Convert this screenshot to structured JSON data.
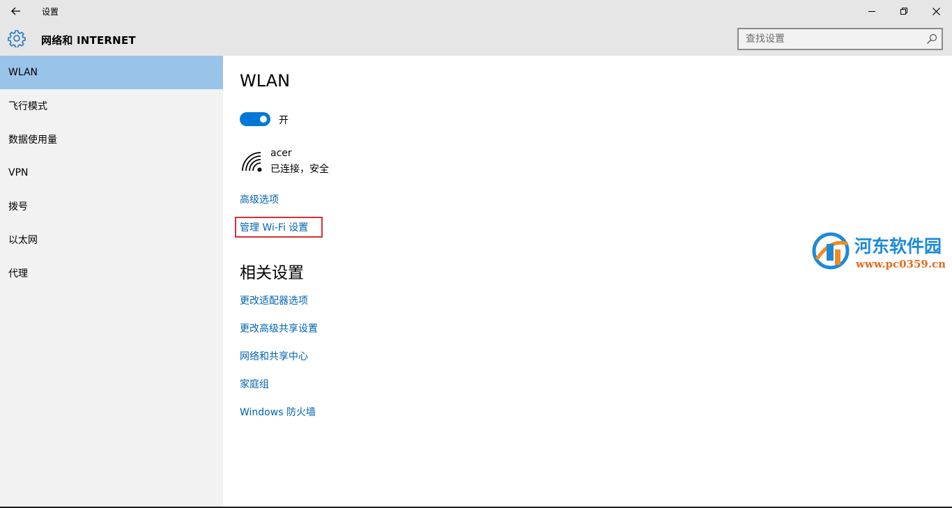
{
  "window": {
    "title": "设置",
    "back_icon": "back-arrow-icon",
    "controls": [
      "minimize-icon",
      "maximize-icon",
      "close-icon"
    ]
  },
  "header": {
    "icon": "gear-icon",
    "title": "网络和 INTERNET",
    "search": {
      "placeholder": "查找设置",
      "value": ""
    }
  },
  "sidebar": {
    "items": [
      {
        "label": "WLAN",
        "active": true
      },
      {
        "label": "飞行模式"
      },
      {
        "label": "数据使用量"
      },
      {
        "label": "VPN"
      },
      {
        "label": "拨号"
      },
      {
        "label": "以太网"
      },
      {
        "label": "代理"
      }
    ]
  },
  "main": {
    "heading": "WLAN",
    "toggle": {
      "state": "on",
      "label": "开"
    },
    "network": {
      "icon": "wifi-signal-icon",
      "name": "acer",
      "status": "已连接，安全"
    },
    "links": [
      "高级选项",
      "管理 Wi-Fi 设置"
    ],
    "related_heading": "相关设置",
    "related_links": [
      "更改适配器选项",
      "更改高级共享设置",
      "网络和共享中心",
      "家庭组",
      "Windows 防火墙"
    ]
  },
  "watermark": {
    "line1": "河东软件园",
    "line2": "www.pc0359.cn"
  },
  "colors": {
    "accent": "#0078d7",
    "link": "#0063b1",
    "selected": "#99c3e8",
    "highlight": "#d9302c"
  }
}
